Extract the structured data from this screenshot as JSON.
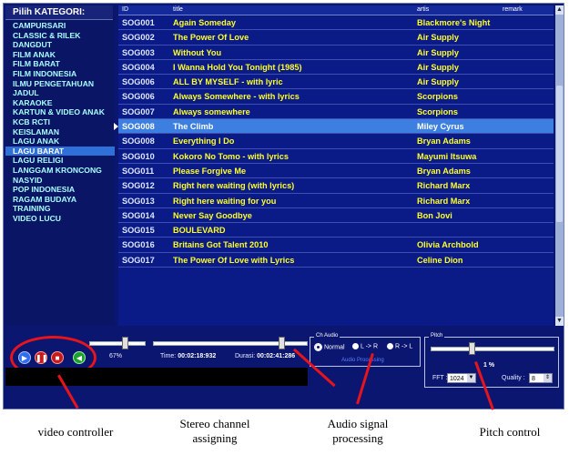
{
  "categories": {
    "header": "Pilih KATEGORI:",
    "items": [
      "CAMPURSARI",
      "CLASSIC & RILEK",
      "DANGDUT",
      "FILM ANAK",
      "FILM BARAT",
      "FILM INDONESIA",
      "ILMU PENGETAHUAN",
      "JADUL",
      "KARAOKE",
      "KARTUN & VIDEO ANAK",
      "KCB RCTI",
      "KEISLAMAN",
      "LAGU ANAK",
      "LAGU BARAT",
      "LAGU RELIGI",
      "LANGGAM KRONCONG",
      "NASYID",
      "POP INDONESIA",
      "RAGAM BUDAYA",
      "TRAINING",
      "VIDEO LUCU"
    ],
    "selected": "LAGU BARAT"
  },
  "table": {
    "columns": [
      "ID",
      "title",
      "artis",
      "remark"
    ],
    "rows": [
      {
        "id": "SOG001",
        "title": "Again Someday",
        "artist": "Blackmore's Night"
      },
      {
        "id": "SOG002",
        "title": "The Power Of Love",
        "artist": "Air Supply"
      },
      {
        "id": "SOG003",
        "title": "Without You",
        "artist": "Air Supply"
      },
      {
        "id": "SOG004",
        "title": "I Wanna Hold You Tonight (1985)",
        "artist": "Air Supply"
      },
      {
        "id": "SOG006",
        "title": "ALL BY MYSELF - with lyric",
        "artist": "Air Supply"
      },
      {
        "id": "SOG006",
        "title": "Always Somewhere - with lyrics",
        "artist": "Scorpions"
      },
      {
        "id": "SOG007",
        "title": "Always somewhere",
        "artist": "Scorpions"
      },
      {
        "id": "SOG008",
        "title": "The Climb",
        "artist": "Miley Cyrus"
      },
      {
        "id": "SOG008",
        "title": "Everything I Do",
        "artist": "Bryan Adams"
      },
      {
        "id": "SOG010",
        "title": "Kokoro No Tomo - with lyrics",
        "artist": "Mayumi Itsuwa"
      },
      {
        "id": "SOG011",
        "title": "Please Forgive Me",
        "artist": "Bryan Adams"
      },
      {
        "id": "SOG012",
        "title": "Right here waiting (with lyrics)",
        "artist": "Richard Marx"
      },
      {
        "id": "SOG013",
        "title": "Right here waiting for you",
        "artist": "Richard Marx"
      },
      {
        "id": "SOG014",
        "title": "Never Say Goodbye",
        "artist": "Bon Jovi"
      },
      {
        "id": "SOG015",
        "title": "BOULEVARD",
        "artist": ""
      },
      {
        "id": "SOG016",
        "title": "Britains Got Talent 2010",
        "artist": "Olivia Archbold"
      },
      {
        "id": "SOG017",
        "title": "The Power Of Love with Lyrics",
        "artist": "Celine Dion"
      }
    ],
    "selected_index": 7
  },
  "controls": {
    "volume": "67%",
    "time_label": "Time:",
    "time_value": "00:02:18:932",
    "duration_label": "Durasi:",
    "duration_value": "00:02:41:286",
    "audio_group": "Ch Audio",
    "radio_normal": "Normal",
    "radio_lr": "L -> R",
    "radio_rl": "R -> L",
    "audio_processing": "Audio Processing",
    "pitch_group": "Pitch",
    "pitch_value": "1 %",
    "fft_label": "FFT :",
    "fft_value": "1024",
    "quality_label": "Quality :",
    "quality_value": "8"
  },
  "annotations": {
    "video_controller": "video controller",
    "stereo": "Stereo channel assigning",
    "audio_signal": "Audio signal processing",
    "pitch": "Pitch control"
  },
  "colors": {
    "background": "#0b1670",
    "category_text": "#a9ffff",
    "song_text": "#ffff2a",
    "selection": "#3d7fe0",
    "annotation": "#e8141b"
  }
}
